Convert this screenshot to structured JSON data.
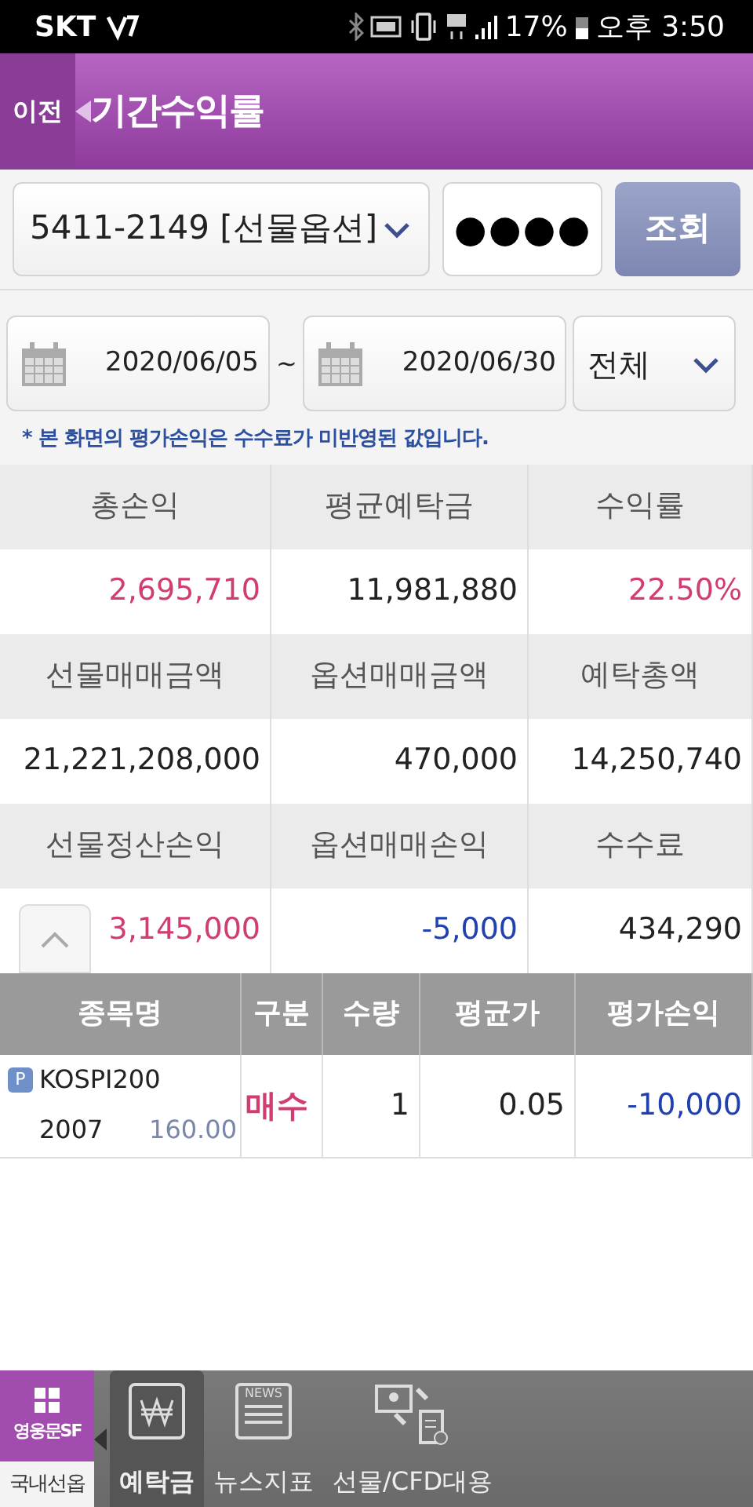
{
  "status_bar": {
    "carrier": "SKT",
    "battery": "17%",
    "time": "오후 3:50"
  },
  "header": {
    "back": "이전",
    "title": "기간수익률"
  },
  "query": {
    "account": "5411-2149 [선물옵션]",
    "password": "●●●●",
    "submit": "조회"
  },
  "period": {
    "start": "2020/06/05",
    "separator": "~",
    "end": "2020/06/30",
    "filter": "전체"
  },
  "notice": "* 본 화면의 평가손익은 수수료가 미반영된 값입니다.",
  "summary": [
    {
      "label": "총손익",
      "value": "2,695,710",
      "kind": "up"
    },
    {
      "label": "평균예탁금",
      "value": "11,981,880",
      "kind": "plain"
    },
    {
      "label": "수익률",
      "value": "22.50%",
      "kind": "up"
    },
    {
      "label": "선물매매금액",
      "value": "21,221,208,000",
      "kind": "plain"
    },
    {
      "label": "옵션매매금액",
      "value": "470,000",
      "kind": "plain"
    },
    {
      "label": "예탁총액",
      "value": "14,250,740",
      "kind": "plain"
    },
    {
      "label": "선물정산손익",
      "value": "3,145,000",
      "kind": "up"
    },
    {
      "label": "옵션매매손익",
      "value": "-5,000",
      "kind": "down"
    },
    {
      "label": "수수료",
      "value": "434,290",
      "kind": "plain"
    }
  ],
  "positions": {
    "columns": [
      "종목명",
      "구분",
      "수량",
      "평균가",
      "평가손익"
    ],
    "rows": [
      {
        "badge": "P",
        "name": "KOSPI200",
        "month": "2007",
        "strike": "160.00",
        "side": {
          "text": "매수",
          "kind": "up"
        },
        "quantity": "1",
        "avg_price": "0.05",
        "pnl": {
          "text": "-10,000",
          "kind": "down"
        }
      }
    ]
  },
  "bottom_bar": {
    "logo": "영웅문SF",
    "menu_label": "국내선옵",
    "items": [
      {
        "label": "예탁금",
        "kind": "won",
        "selected": true
      },
      {
        "label": "뉴스지표",
        "kind": "news",
        "icon_text": "NEWS",
        "selected": false
      },
      {
        "label": "선물/CFD대용",
        "kind": "transfer",
        "selected": false
      }
    ]
  }
}
